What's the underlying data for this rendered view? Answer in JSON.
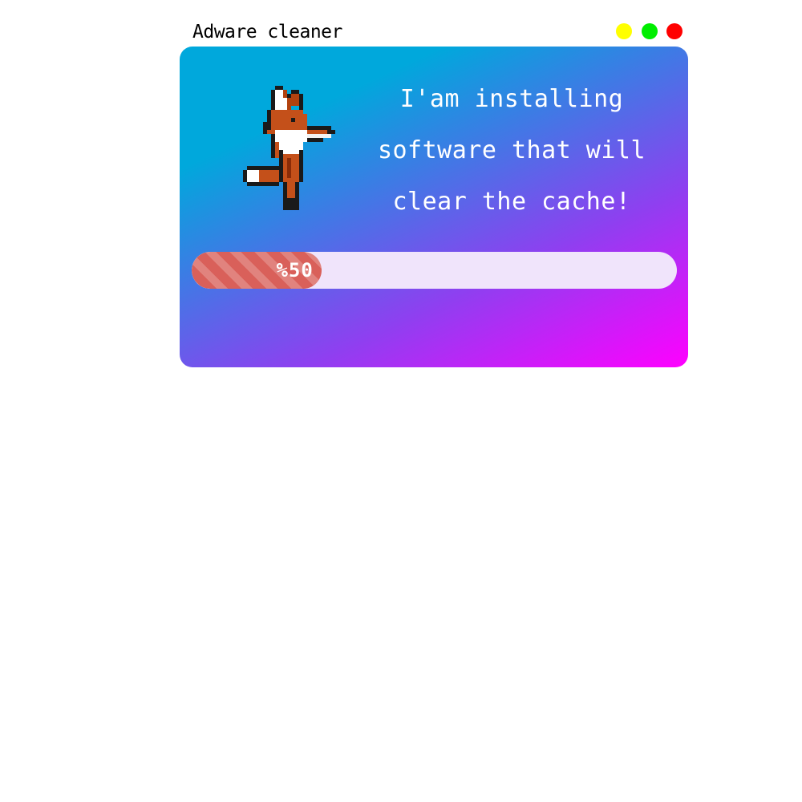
{
  "window": {
    "title": "Adware cleaner",
    "buttons": {
      "minimize_color": "#ffff00",
      "maximize_color": "#00ee00",
      "close_color": "#ff0000"
    }
  },
  "panel": {
    "gradient_from": "#00a8dc",
    "gradient_mid": "#8f3ff0",
    "gradient_to": "#ff00ff",
    "mascot_icon": "pixel-fox-icon",
    "message": "I'am installing\nsoftware that will\nclear the cache!"
  },
  "progress": {
    "percent": 50,
    "label": "%50",
    "fill_color": "#d9605a",
    "track_color": "#f0e4fb"
  }
}
